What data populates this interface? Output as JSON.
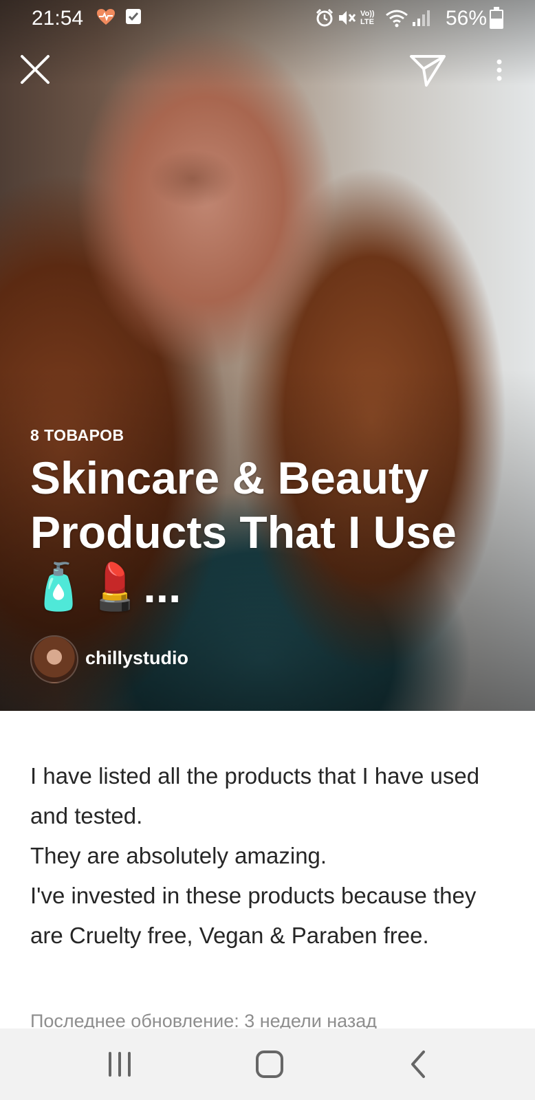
{
  "status_bar": {
    "time": "21:54",
    "battery_percent": "56%",
    "battery_level": 0.56,
    "icons": [
      "heart-rate-icon",
      "check-box-icon",
      "alarm-icon",
      "mute-icon",
      "volte-icon",
      "wifi-icon",
      "signal-icon",
      "battery-icon"
    ],
    "volte_label": "Vo)) LTE"
  },
  "header": {
    "close_icon": "close-icon",
    "share_icon": "send-icon",
    "more_icon": "more-vertical-icon"
  },
  "guide": {
    "item_count": "8 ТОВАРОВ",
    "title": "Skincare & Beauty Products That I Use 🧴💄...",
    "author": "chillystudio"
  },
  "description": {
    "lines": [
      "I have listed all the products that I have used and tested.",
      "They are absolutely amazing.",
      "I've invested in these products because they are Cruelty free, Vegan & Paraben free."
    ],
    "last_updated": "Последнее обновление: 3 недели назад"
  },
  "nav_bar": {
    "recents_icon": "recent-apps-icon",
    "home_icon": "home-icon",
    "back_icon": "back-icon"
  },
  "colors": {
    "text_primary": "#262626",
    "text_secondary": "#8e8e8e",
    "nav_background": "#f2f2f2",
    "overlay_text": "#ffffff"
  }
}
